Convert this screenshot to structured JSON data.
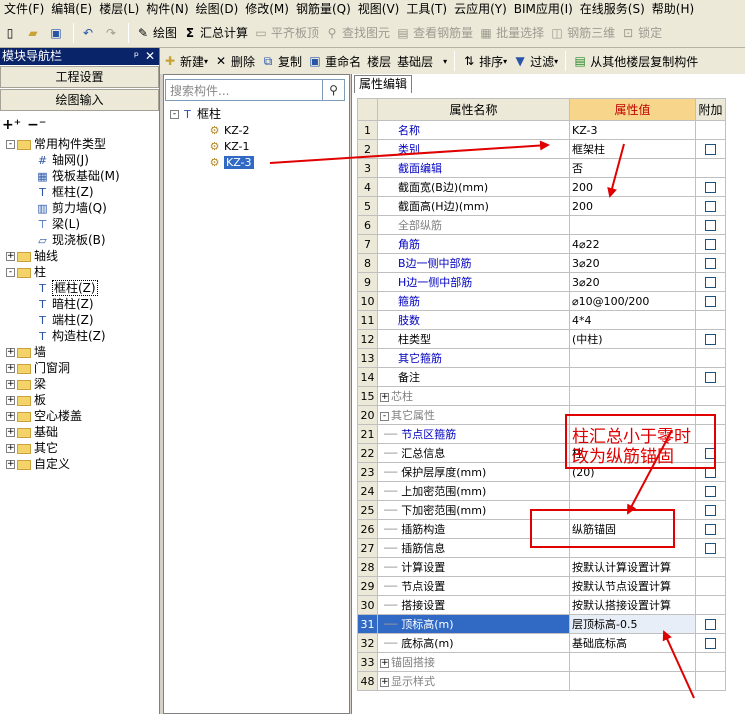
{
  "menu": [
    "文件(F)",
    "编辑(E)",
    "楼层(L)",
    "构件(N)",
    "绘图(D)",
    "修改(M)",
    "钢筋量(Q)",
    "视图(V)",
    "工具(T)",
    "云应用(Y)",
    "BIM应用(I)",
    "在线服务(S)",
    "帮助(H)"
  ],
  "toolbar1": {
    "draw": "绘图",
    "summary": "汇总计算",
    "flat_slab": "平齐板顶",
    "find_elem": "查找图元",
    "view_rebar": "查看钢筋量",
    "batch_select": "批量选择",
    "rebar_3d": "钢筋三维",
    "lock": "锁定"
  },
  "toolbar2": {
    "new": "新建",
    "delete": "删除",
    "copy": "复制",
    "rename": "重命名",
    "floor_label": "楼层",
    "floor_value": "基础层",
    "sort": "排序",
    "filter": "过滤",
    "copy_from": "从其他楼层复制构件"
  },
  "nav": {
    "title": "模块导航栏",
    "btn_project": "工程设置",
    "btn_draw": "绘图输入",
    "tree": [
      {
        "level": 0,
        "toggle": "-",
        "folder": true,
        "label": "常用构件类型"
      },
      {
        "level": 1,
        "icon": "grid-icon",
        "label": "轴网(J)"
      },
      {
        "level": 1,
        "icon": "raft-icon",
        "label": "筏板基础(M)"
      },
      {
        "level": 1,
        "icon": "column-icon",
        "label": "框柱(Z)"
      },
      {
        "level": 1,
        "icon": "shearwall-icon",
        "label": "剪力墙(Q)"
      },
      {
        "level": 1,
        "icon": "beam-icon",
        "label": "梁(L)"
      },
      {
        "level": 1,
        "icon": "slab-icon",
        "label": "现浇板(B)"
      },
      {
        "level": 0,
        "toggle": "+",
        "folder": true,
        "label": "轴线"
      },
      {
        "level": 0,
        "toggle": "-",
        "folder": true,
        "label": "柱"
      },
      {
        "level": 1,
        "icon": "column-icon",
        "label": "框柱(Z)",
        "highlight": true
      },
      {
        "level": 1,
        "icon": "column-icon",
        "label": "暗柱(Z)"
      },
      {
        "level": 1,
        "icon": "column-icon",
        "label": "端柱(Z)"
      },
      {
        "level": 1,
        "icon": "column-icon",
        "label": "构造柱(Z)"
      },
      {
        "level": 0,
        "toggle": "+",
        "folder": true,
        "label": "墙"
      },
      {
        "level": 0,
        "toggle": "+",
        "folder": true,
        "label": "门窗洞"
      },
      {
        "level": 0,
        "toggle": "+",
        "folder": true,
        "label": "梁"
      },
      {
        "level": 0,
        "toggle": "+",
        "folder": true,
        "label": "板"
      },
      {
        "level": 0,
        "toggle": "+",
        "folder": true,
        "label": "空心楼盖"
      },
      {
        "level": 0,
        "toggle": "+",
        "folder": true,
        "label": "基础"
      },
      {
        "level": 0,
        "toggle": "+",
        "folder": true,
        "label": "其它"
      },
      {
        "level": 0,
        "toggle": "+",
        "folder": true,
        "label": "自定义"
      }
    ]
  },
  "component_panel": {
    "search_placeholder": "搜索构件...",
    "root": "框柱",
    "items": [
      "KZ-2",
      "KZ-1",
      "KZ-3"
    ],
    "selected_index": 2
  },
  "props": {
    "tab": "属性编辑",
    "col_name": "属性名称",
    "col_value": "属性值",
    "col_extra": "附加",
    "rows": [
      {
        "n": "1",
        "name": "名称",
        "value": "KZ-3",
        "style": "blue",
        "cb": false
      },
      {
        "n": "2",
        "name": "类别",
        "value": "框架柱",
        "style": "blue",
        "cb": true
      },
      {
        "n": "3",
        "name": "截面编辑",
        "value": "否",
        "style": "blue",
        "cb": false
      },
      {
        "n": "4",
        "name": "截面宽(B边)(mm)",
        "value": "200",
        "style": "",
        "cb": true
      },
      {
        "n": "5",
        "name": "截面高(H边)(mm)",
        "value": "200",
        "style": "",
        "cb": true
      },
      {
        "n": "6",
        "name": "全部纵筋",
        "value": "",
        "style": "gray",
        "cb": true
      },
      {
        "n": "7",
        "name": "角筋",
        "value": "4⌀22",
        "style": "blue",
        "cb": true
      },
      {
        "n": "8",
        "name": "B边一侧中部筋",
        "value": "3⌀20",
        "style": "blue",
        "cb": true
      },
      {
        "n": "9",
        "name": "H边一侧中部筋",
        "value": "3⌀20",
        "style": "blue",
        "cb": true
      },
      {
        "n": "10",
        "name": "箍筋",
        "value": "⌀10@100/200",
        "style": "blue",
        "cb": true
      },
      {
        "n": "11",
        "name": "肢数",
        "value": "4*4",
        "style": "blue",
        "cb": false
      },
      {
        "n": "12",
        "name": "柱类型",
        "value": "(中柱)",
        "style": "",
        "cb": true
      },
      {
        "n": "13",
        "name": "其它箍筋",
        "value": "",
        "style": "blue",
        "cb": false
      },
      {
        "n": "14",
        "name": "备注",
        "value": "",
        "style": "",
        "cb": true
      },
      {
        "n": "15",
        "name": "芯柱",
        "value": "",
        "style": "gray",
        "toggle": "+",
        "cb": false
      },
      {
        "n": "20",
        "name": "其它属性",
        "value": "",
        "style": "gray",
        "toggle": "-",
        "cb": false
      },
      {
        "n": "21",
        "name": "节点区箍筋",
        "value": "",
        "style": "blue",
        "indent": true,
        "cb": false
      },
      {
        "n": "22",
        "name": "汇总信息",
        "value": "柱",
        "style": "",
        "indent": true,
        "cb": true
      },
      {
        "n": "23",
        "name": "保护层厚度(mm)",
        "value": "(20)",
        "style": "",
        "indent": true,
        "cb": true
      },
      {
        "n": "24",
        "name": "上加密范围(mm)",
        "value": "",
        "style": "",
        "indent": true,
        "cb": true
      },
      {
        "n": "25",
        "name": "下加密范围(mm)",
        "value": "",
        "style": "",
        "indent": true,
        "cb": true
      },
      {
        "n": "26",
        "name": "插筋构造",
        "value": "纵筋锚固",
        "style": "",
        "indent": true,
        "cb": true
      },
      {
        "n": "27",
        "name": "插筋信息",
        "value": "",
        "style": "",
        "indent": true,
        "cb": true
      },
      {
        "n": "28",
        "name": "计算设置",
        "value": "按默认计算设置计算",
        "style": "",
        "indent": true,
        "cb": false
      },
      {
        "n": "29",
        "name": "节点设置",
        "value": "按默认节点设置计算",
        "style": "",
        "indent": true,
        "cb": false
      },
      {
        "n": "30",
        "name": "搭接设置",
        "value": "按默认搭接设置计算",
        "style": "",
        "indent": true,
        "cb": false
      },
      {
        "n": "31",
        "name": "顶标高(m)",
        "value": "层顶标高-0.5",
        "style": "",
        "indent": true,
        "cb": true,
        "selected": true
      },
      {
        "n": "32",
        "name": "底标高(m)",
        "value": "基础底标高",
        "style": "",
        "indent": true,
        "cb": true
      },
      {
        "n": "33",
        "name": "锚固搭接",
        "value": "",
        "style": "gray",
        "toggle": "+",
        "cb": false
      },
      {
        "n": "48",
        "name": "显示样式",
        "value": "",
        "style": "gray",
        "toggle": "+",
        "cb": false
      }
    ]
  },
  "annotation": {
    "line1": "柱汇总小于零时",
    "line2": "改为纵筋锚固"
  }
}
